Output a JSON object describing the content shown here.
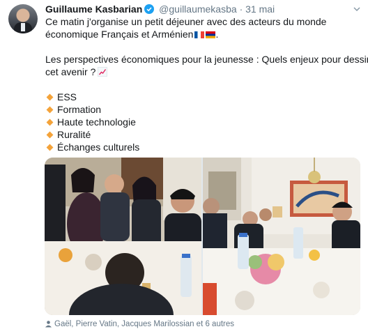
{
  "tweet": {
    "author_name": "Guillaume Kasbarian",
    "handle": "@guillaumekasba",
    "separator": "·",
    "date": "31 mai",
    "line1": "Ce matin j'organise un petit déjeuner avec des acteurs du monde",
    "line2": "économique Français et Arménien",
    "line3": "Les perspectives économiques pour la jeunesse : Quels enjeux pour dessiner",
    "line4": "cet avenir ?",
    "topics": [
      "ESS",
      "Formation",
      "Haute technologie",
      "Ruralité",
      "Échanges culturels"
    ],
    "tagged_people": "Gaël, Pierre Vatin, Jacques Marilossian et 6 autres"
  },
  "colors": {
    "verified_blue": "#1da1f2",
    "secondary_text": "#657786",
    "bullet_orange": "#f4a33a"
  },
  "icons": {
    "verified": "verified-badge-icon",
    "menu": "chevron-down-icon",
    "flags": [
      "flag-france-icon",
      "flag-armenia-icon"
    ],
    "emoji": "chart-increasing-icon",
    "bullet": "orange-diamond-icon",
    "tag": "person-tag-icon"
  }
}
